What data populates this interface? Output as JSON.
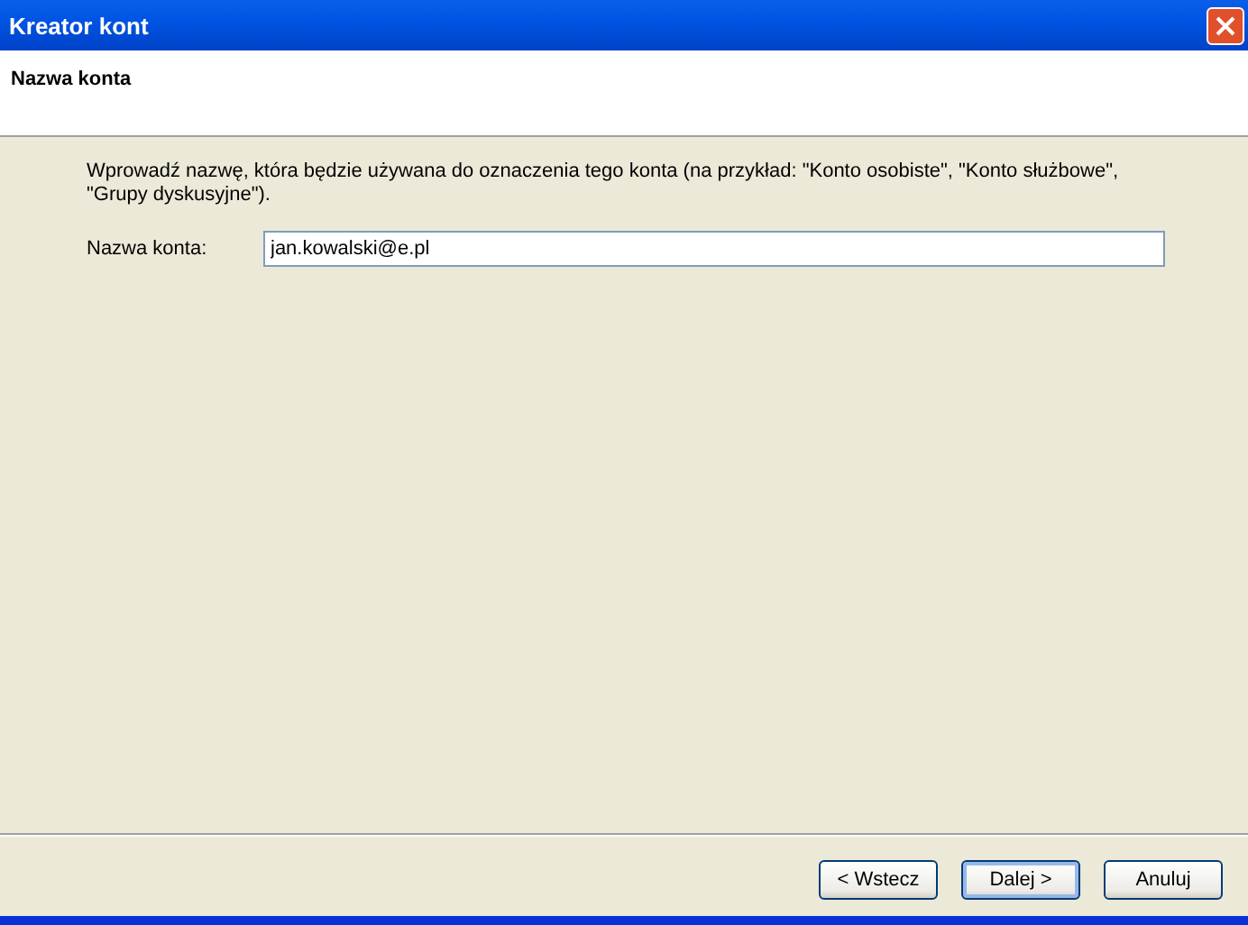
{
  "window": {
    "title": "Kreator kont"
  },
  "header": {
    "title": "Nazwa konta"
  },
  "description": "Wprowadź nazwę, która będzie używana do oznaczenia tego konta (na przykład: \"Konto osobiste\", \"Konto służbowe\", \"Grupy dyskusyjne\").",
  "field": {
    "label": "Nazwa konta:",
    "value": "jan.kowalski@e.pl"
  },
  "buttons": [
    {
      "label": "< Wstecz",
      "default": false
    },
    {
      "label": "Dalej >",
      "default": true
    },
    {
      "label": "Anuluj",
      "default": false
    }
  ]
}
